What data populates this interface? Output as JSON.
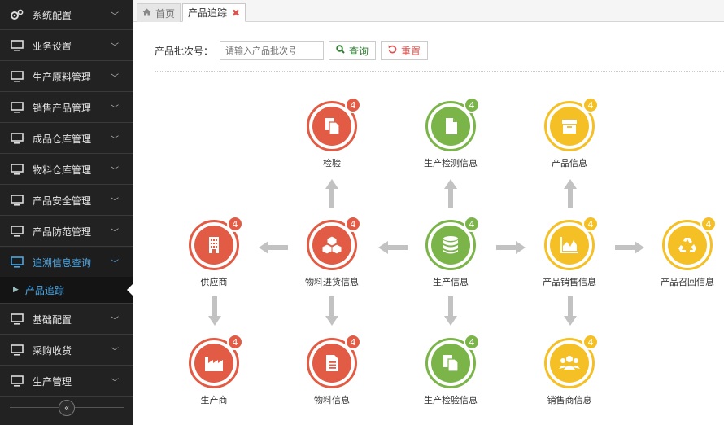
{
  "sidebar": {
    "items": [
      {
        "label": "系统配置",
        "icon": "gears-icon"
      },
      {
        "label": "业务设置",
        "icon": "monitor-icon"
      },
      {
        "label": "生产原料管理",
        "icon": "monitor-icon"
      },
      {
        "label": "销售产品管理",
        "icon": "monitor-icon"
      },
      {
        "label": "成品仓库管理",
        "icon": "monitor-icon"
      },
      {
        "label": "物料仓库管理",
        "icon": "monitor-icon"
      },
      {
        "label": "产品安全管理",
        "icon": "monitor-icon"
      },
      {
        "label": "产品防范管理",
        "icon": "monitor-icon"
      },
      {
        "label": "追溯信息查询",
        "icon": "monitor-icon",
        "active": true
      },
      {
        "label": "基础配置",
        "icon": "monitor-icon"
      },
      {
        "label": "采购收货",
        "icon": "monitor-icon"
      },
      {
        "label": "生产管理",
        "icon": "monitor-icon"
      }
    ],
    "sub_item": "产品追踪",
    "collapse_glyph": "«"
  },
  "tabs": {
    "home": "首页",
    "current": "产品追踪",
    "close_glyph": "✖"
  },
  "search": {
    "label": "产品批次号：",
    "placeholder": "请输入产品批次号",
    "search_button": "查询",
    "reset_button": "重置"
  },
  "colors": {
    "red": "#e25b45",
    "green": "#7bb54a",
    "yellow": "#f5c026",
    "sidebar_bg": "#222222",
    "active_blue": "#4aa8e8"
  },
  "nodes": {
    "inspection": {
      "label": "检验",
      "badge": "4",
      "icon": "documents-icon"
    },
    "prod_test": {
      "label": "生产检测信息",
      "badge": "4",
      "icon": "file-icon"
    },
    "product_info": {
      "label": "产品信息",
      "badge": "4",
      "icon": "archive-box-icon"
    },
    "supplier": {
      "label": "供应商",
      "badge": "4",
      "icon": "building-icon"
    },
    "material_in": {
      "label": "物料进货信息",
      "badge": "4",
      "icon": "cubes-icon"
    },
    "production": {
      "label": "生产信息",
      "badge": "4",
      "icon": "database-icon"
    },
    "product_sales": {
      "label": "产品销售信息",
      "badge": "4",
      "icon": "area-chart-icon"
    },
    "recall": {
      "label": "产品召回信息",
      "badge": "4",
      "icon": "recycle-icon"
    },
    "manufacturer": {
      "label": "生产商",
      "badge": "4",
      "icon": "factory-icon"
    },
    "material_info": {
      "label": "物料信息",
      "badge": "4",
      "icon": "document-icon"
    },
    "prod_inspect": {
      "label": "生产检验信息",
      "badge": "4",
      "icon": "copy-icon"
    },
    "dealer": {
      "label": "销售商信息",
      "badge": "4",
      "icon": "users-icon"
    }
  }
}
